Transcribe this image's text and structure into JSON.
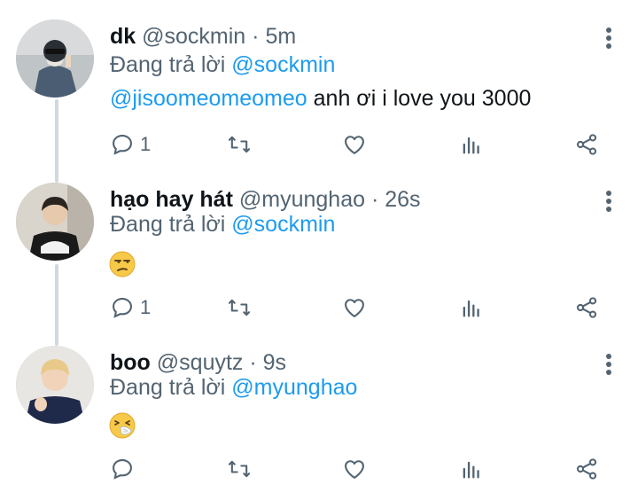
{
  "reply_prefix": "Đang trả lời",
  "tweets": [
    {
      "name": "dk",
      "handle": "@sockmin",
      "separator": "·",
      "time": "5m",
      "reply_to": "@sockmin",
      "mention": "@jisoomeomeomeo",
      "text": " anh ơi i love you 3000",
      "reply_count": "1"
    },
    {
      "name": "hạo hay hát",
      "handle": "@myunghao",
      "separator": "·",
      "time": "26s",
      "reply_to": "@sockmin",
      "reply_count": "1"
    },
    {
      "name": "boo",
      "handle": "@squytz",
      "separator": "·",
      "time": "9s",
      "reply_to": "@myunghao",
      "reply_count": ""
    }
  ],
  "colors": {
    "accent": "#1d9bf0",
    "muted": "#536471",
    "text": "#0f1419",
    "thread": "#cfd9de"
  },
  "icons": [
    "reply-icon",
    "retweet-icon",
    "like-icon",
    "analytics-icon",
    "share-icon",
    "more-options-icon",
    "unamused-emoji",
    "sneezing-emoji"
  ]
}
